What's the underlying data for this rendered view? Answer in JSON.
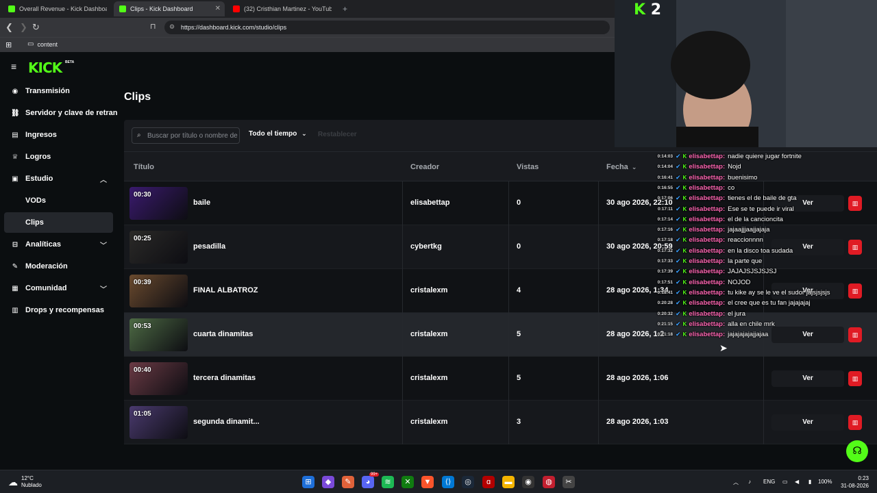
{
  "browser": {
    "tabs": [
      {
        "label": "Overall Revenue - Kick Dashboard",
        "favicon_color": "#53fc18"
      },
      {
        "label": "Clips - Kick Dashboard",
        "favicon_color": "#53fc18"
      },
      {
        "label": "(32) Cristhian Martinez - YouTube",
        "favicon_color": "#ff0000"
      }
    ],
    "url": "https://dashboard.kick.com/studio/clips",
    "bookmark": "content"
  },
  "header": {
    "logo": "KICK",
    "beta": "BETA"
  },
  "sidebar": {
    "items": [
      {
        "label": "Transmisión",
        "icon": "record-icon"
      },
      {
        "label": "Servidor y clave de retransmisión",
        "icon": "link-icon"
      },
      {
        "label": "Ingresos",
        "icon": "chart-icon"
      },
      {
        "label": "Logros",
        "icon": "trophy-icon"
      },
      {
        "label": "Estudio",
        "icon": "film-icon",
        "expanded": true
      },
      {
        "label": "Analíticas",
        "icon": "analytics-icon"
      },
      {
        "label": "Moderación",
        "icon": "wrench-icon"
      },
      {
        "label": "Comunidad",
        "icon": "community-icon"
      },
      {
        "label": "Drops y recompensas",
        "icon": "gift-icon"
      }
    ],
    "sub_items": [
      {
        "label": "VODs"
      },
      {
        "label": "Clips",
        "active": true
      }
    ]
  },
  "page": {
    "title": "Clips",
    "search_placeholder": "Buscar por título o nombre de creador",
    "time_filter": "Todo el tiempo",
    "reset_label": "Restablecer",
    "columns": {
      "title": "Título",
      "creator": "Creador",
      "views": "Vistas",
      "date": "Fecha"
    },
    "view_label": "Ver"
  },
  "clips": [
    {
      "duration": "00:30",
      "title": "baile",
      "creator": "elisabettap",
      "views": "0",
      "date": "30 ago 2026, 22:10",
      "thumb": "#3a1a6e"
    },
    {
      "duration": "00:25",
      "title": "pesadilla",
      "creator": "cybertkg",
      "views": "0",
      "date": "30 ago 2026, 20:59",
      "thumb": "#2b2a28"
    },
    {
      "duration": "00:39",
      "title": "FINAL ALBATROZ",
      "creator": "cristalexm",
      "views": "4",
      "date": "28 ago 2026, 1:34",
      "thumb": "#6a4a2e"
    },
    {
      "duration": "00:53",
      "title": "cuarta dinamitas",
      "creator": "cristalexm",
      "views": "5",
      "date": "28 ago 2026, 1:2",
      "thumb": "#4d6a44"
    },
    {
      "duration": "00:40",
      "title": "tercera dinamitas",
      "creator": "cristalexm",
      "views": "5",
      "date": "28 ago 2026, 1:06",
      "thumb": "#6a3a44"
    },
    {
      "duration": "01:05",
      "title": "segunda dinamit...",
      "creator": "cristalexm",
      "views": "3",
      "date": "28 ago 2026, 1:03",
      "thumb": "#4a3a6e"
    }
  ],
  "chat": [
    {
      "ts": "0:14:03",
      "user": "elisabettap:",
      "msg": "nadie quiere jugar fortnite"
    },
    {
      "ts": "0:14:04",
      "user": "elisabettap:",
      "msg": "Nojd"
    },
    {
      "ts": "0:16:41",
      "user": "elisabettap:",
      "msg": "buenisimo"
    },
    {
      "ts": "0:16:55",
      "user": "elisabettap:",
      "msg": "co"
    },
    {
      "ts": "0:17:06",
      "user": "elisabettap:",
      "msg": "tienes el de baile de gta"
    },
    {
      "ts": "0:17:11",
      "user": "elisabettap:",
      "msg": "Ese se te puede ir viral"
    },
    {
      "ts": "0:17:14",
      "user": "elisabettap:",
      "msg": "el de la cancioncita"
    },
    {
      "ts": "0:17:16",
      "user": "elisabettap:",
      "msg": "jajaajjjaajjajaja"
    },
    {
      "ts": "0:17:18",
      "user": "elisabettap:",
      "msg": "reaccionnnn"
    },
    {
      "ts": "0:17:32",
      "user": "elisabettap:",
      "msg": "en la disco toa sudada"
    },
    {
      "ts": "0:17:33",
      "user": "elisabettap:",
      "msg": "la parte que"
    },
    {
      "ts": "0:17:39",
      "user": "elisabettap:",
      "msg": "JAJAJSJSJSJSJ"
    },
    {
      "ts": "0:17:51",
      "user": "elisabettap:",
      "msg": "NOJOD"
    },
    {
      "ts": "0:18:41",
      "user": "elisabettap:",
      "msg": "tu kike ay se le ve el sudor jajsjsjsjs"
    },
    {
      "ts": "0:20:28",
      "user": "elisabettap:",
      "msg": "el cree que es tu fan jajajajaj"
    },
    {
      "ts": "0:20:32",
      "user": "elisabettap:",
      "msg": "el jura"
    },
    {
      "ts": "0:21:15",
      "user": "elisabettap:",
      "msg": "alla en chile mrk"
    },
    {
      "ts": "0:21:18",
      "user": "elisabettap:",
      "msg": "jajajajajajjajaa"
    }
  ],
  "cam": {
    "logo_k": "K",
    "logo_num": "2"
  },
  "taskbar": {
    "temp": "12°C",
    "weather": "Nublado",
    "lang": "ENG",
    "battery": "100%",
    "time": "0:23",
    "date": "31-08-2026",
    "badge": "99+"
  },
  "colors": {
    "accent": "#53fc18",
    "danger": "#e01b24",
    "chat_user": "#ff66b3"
  }
}
